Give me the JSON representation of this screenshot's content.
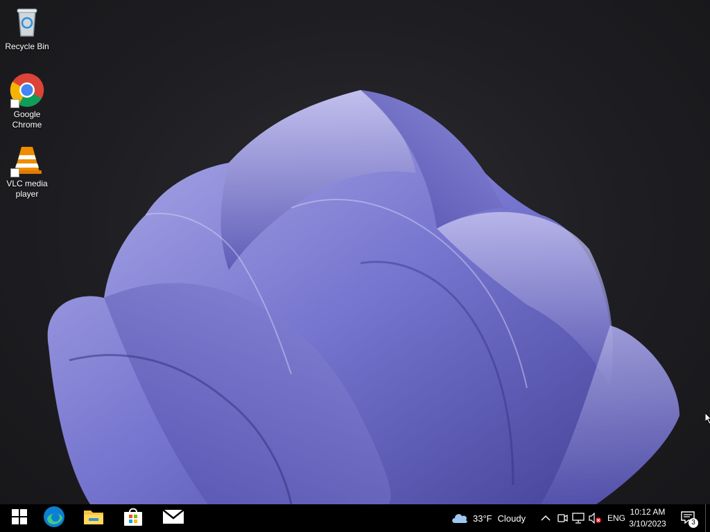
{
  "desktop": {
    "icons": [
      {
        "label": "Recycle Bin",
        "icon": "recycle-bin-icon"
      },
      {
        "label": "Google\nChrome",
        "icon": "chrome-icon"
      },
      {
        "label": "VLC media\nplayer",
        "icon": "vlc-icon"
      }
    ],
    "wallpaper": "windows-11-bloom"
  },
  "taskbar": {
    "start_icon": "windows-start-icon",
    "pinned": [
      {
        "name": "Microsoft Edge",
        "icon": "edge-icon"
      },
      {
        "name": "File Explorer",
        "icon": "file-explorer-icon"
      },
      {
        "name": "Microsoft Store",
        "icon": "store-icon"
      },
      {
        "name": "Mail",
        "icon": "mail-icon"
      }
    ],
    "weather": {
      "temp": "33°F",
      "condition": "Cloudy",
      "icon": "cloud-icon"
    },
    "tray": {
      "language": "ENG",
      "icons": [
        "chevron-up-icon",
        "meet-now-icon",
        "network-icon",
        "volume-muted-icon"
      ]
    },
    "clock": {
      "time": "10:12 AM",
      "date": "3/10/2023"
    },
    "notifications": {
      "count": "3",
      "icon": "notification-center-icon"
    }
  },
  "colors": {
    "taskbar": "#000000",
    "bloom": "#6b6ac4",
    "bloom_light": "#a9a8e0",
    "background": "#1c1c1f"
  }
}
